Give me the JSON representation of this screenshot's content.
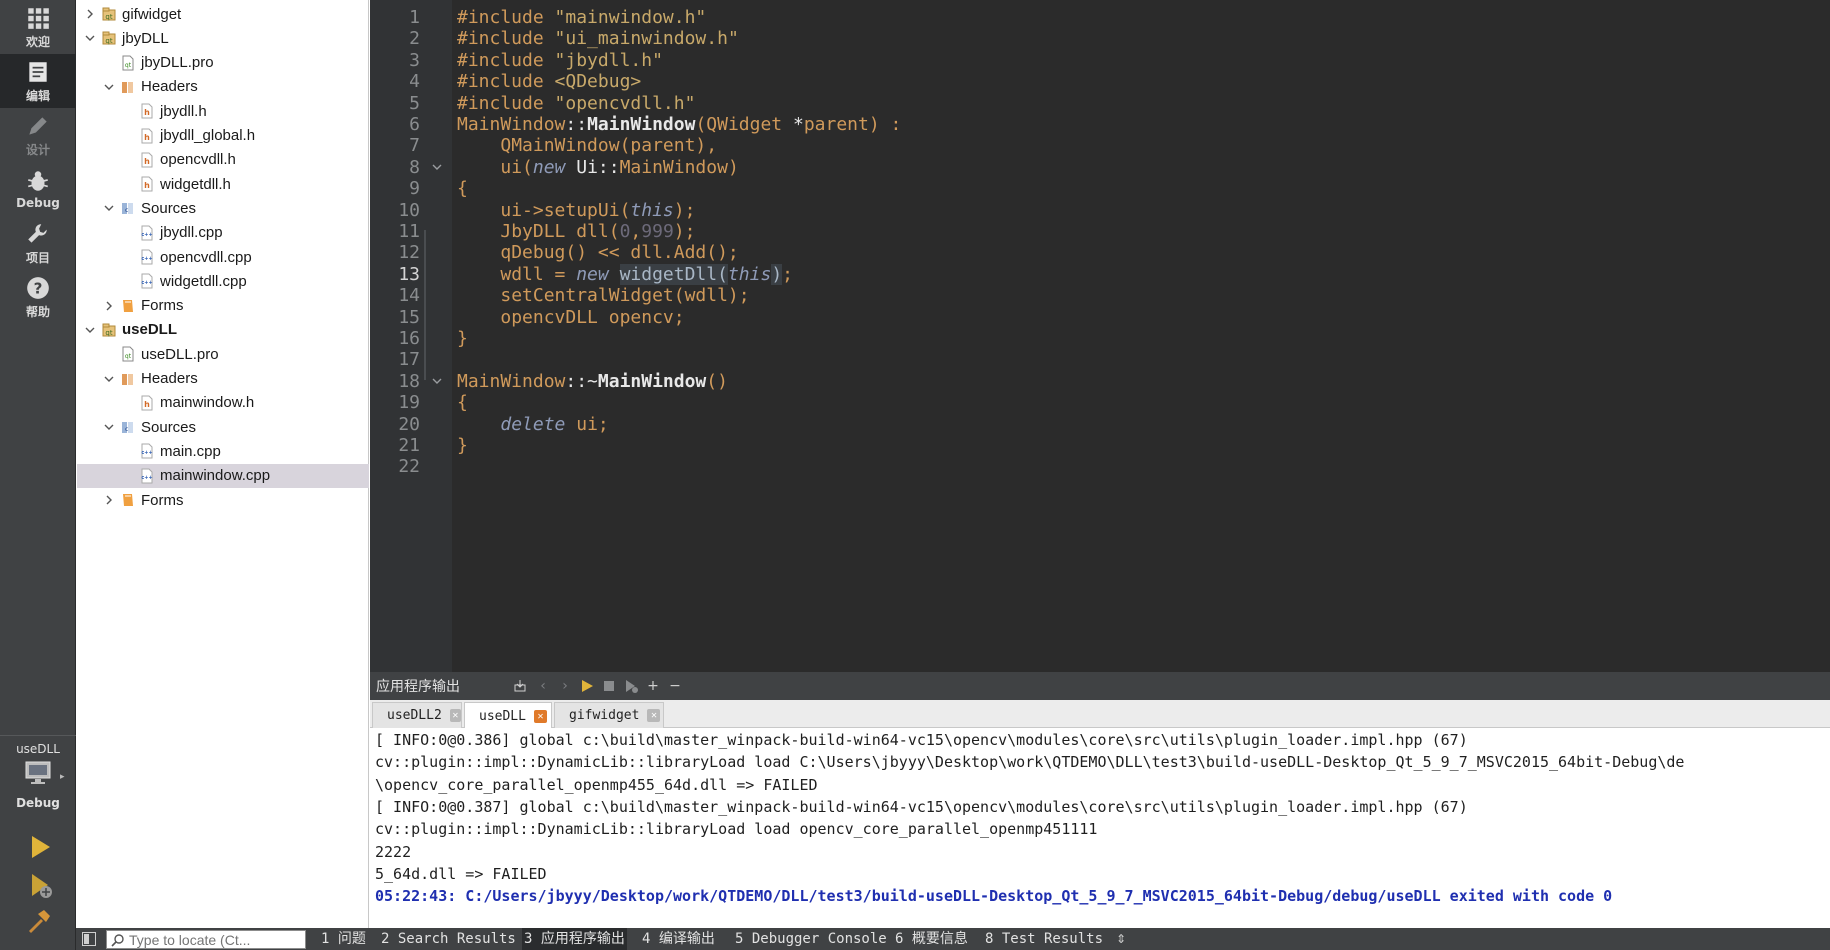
{
  "modes": [
    {
      "label": "欢迎",
      "icon": "grid-icon"
    },
    {
      "label": "编辑",
      "icon": "edit-document-icon"
    },
    {
      "label": "设计",
      "icon": "pencil-icon"
    },
    {
      "label": "Debug",
      "icon": "bug-icon"
    },
    {
      "label": "项目",
      "icon": "wrench-icon"
    },
    {
      "label": "帮助",
      "icon": "help-icon"
    }
  ],
  "kit": {
    "project": "useDLL",
    "config": "Debug"
  },
  "tree": [
    {
      "label": "gifwidget",
      "type": "project",
      "arrow": "right",
      "depth": 0,
      "bold": false
    },
    {
      "label": "jbyDLL",
      "type": "project",
      "arrow": "down",
      "depth": 0,
      "bold": false
    },
    {
      "label": "jbyDLL.pro",
      "type": "pro",
      "arrow": "",
      "depth": 1,
      "bold": false
    },
    {
      "label": "Headers",
      "type": "folder-h",
      "arrow": "down",
      "depth": 1,
      "bold": false
    },
    {
      "label": "jbydll.h",
      "type": "h",
      "arrow": "",
      "depth": 2,
      "bold": false
    },
    {
      "label": "jbydll_global.h",
      "type": "h",
      "arrow": "",
      "depth": 2,
      "bold": false
    },
    {
      "label": "opencvdll.h",
      "type": "h",
      "arrow": "",
      "depth": 2,
      "bold": false
    },
    {
      "label": "widgetdll.h",
      "type": "h",
      "arrow": "",
      "depth": 2,
      "bold": false
    },
    {
      "label": "Sources",
      "type": "folder-c",
      "arrow": "down",
      "depth": 1,
      "bold": false
    },
    {
      "label": "jbydll.cpp",
      "type": "cpp",
      "arrow": "",
      "depth": 2,
      "bold": false
    },
    {
      "label": "opencvdll.cpp",
      "type": "cpp",
      "arrow": "",
      "depth": 2,
      "bold": false
    },
    {
      "label": "widgetdll.cpp",
      "type": "cpp",
      "arrow": "",
      "depth": 2,
      "bold": false
    },
    {
      "label": "Forms",
      "type": "folder-f",
      "arrow": "right",
      "depth": 1,
      "bold": false
    },
    {
      "label": "useDLL",
      "type": "project",
      "arrow": "down",
      "depth": 0,
      "bold": true
    },
    {
      "label": "useDLL.pro",
      "type": "pro",
      "arrow": "",
      "depth": 1,
      "bold": false
    },
    {
      "label": "Headers",
      "type": "folder-h",
      "arrow": "down",
      "depth": 1,
      "bold": false
    },
    {
      "label": "mainwindow.h",
      "type": "h",
      "arrow": "",
      "depth": 2,
      "bold": false
    },
    {
      "label": "Sources",
      "type": "folder-c",
      "arrow": "down",
      "depth": 1,
      "bold": false
    },
    {
      "label": "main.cpp",
      "type": "cpp",
      "arrow": "",
      "depth": 2,
      "bold": false
    },
    {
      "label": "mainwindow.cpp",
      "type": "cpp",
      "arrow": "",
      "depth": 2,
      "bold": false,
      "selected": true
    },
    {
      "label": "Forms",
      "type": "folder-f",
      "arrow": "right",
      "depth": 1,
      "bold": false
    }
  ],
  "editor": {
    "current_line": "13",
    "lines": [
      {
        "n": "1",
        "fold": "",
        "tokens": [
          [
            "kw",
            "#include "
          ],
          [
            "str",
            "\"mainwindow.h\""
          ]
        ]
      },
      {
        "n": "2",
        "fold": "",
        "tokens": [
          [
            "kw",
            "#include "
          ],
          [
            "str",
            "\"ui_mainwindow.h\""
          ]
        ]
      },
      {
        "n": "3",
        "fold": "",
        "tokens": [
          [
            "kw",
            "#include "
          ],
          [
            "str",
            "\"jbydll.h\""
          ]
        ]
      },
      {
        "n": "4",
        "fold": "",
        "tokens": [
          [
            "kw",
            "#include "
          ],
          [
            "str",
            "<QDebug>"
          ]
        ]
      },
      {
        "n": "5",
        "fold": "",
        "tokens": [
          [
            "kw",
            "#include "
          ],
          [
            "str",
            "\"opencvdll.h\""
          ]
        ]
      },
      {
        "n": "6",
        "fold": "",
        "tokens": [
          [
            "cls",
            "MainWindow"
          ],
          [
            "std",
            "::"
          ],
          [
            "fn",
            "MainWindow"
          ],
          [
            "cls",
            "(QWidget "
          ],
          [
            "std",
            "*"
          ],
          [
            "cls",
            "parent) :"
          ]
        ]
      },
      {
        "n": "7",
        "fold": "",
        "tokens": [
          [
            "std",
            "    "
          ],
          [
            "cls",
            "QMainWindow(parent),"
          ]
        ]
      },
      {
        "n": "8",
        "fold": "down",
        "tokens": [
          [
            "std",
            "    "
          ],
          [
            "cls",
            "ui("
          ],
          [
            "ital",
            "new"
          ],
          [
            "std",
            " Ui::"
          ],
          [
            "cls",
            "MainWindow)"
          ]
        ]
      },
      {
        "n": "9",
        "fold": "",
        "tokens": [
          [
            "cls",
            "{"
          ]
        ]
      },
      {
        "n": "10",
        "fold": "",
        "tokens": [
          [
            "std",
            "    "
          ],
          [
            "cls",
            "ui->setupUi("
          ],
          [
            "ital",
            "this"
          ],
          [
            "cls",
            ");"
          ]
        ]
      },
      {
        "n": "11",
        "fold": "",
        "tokens": [
          [
            "std",
            "    "
          ],
          [
            "cls",
            "JbyDLL dll("
          ],
          [
            "num",
            "0"
          ],
          [
            "cls",
            ","
          ],
          [
            "num",
            "999"
          ],
          [
            "cls",
            ");"
          ]
        ]
      },
      {
        "n": "12",
        "fold": "",
        "tokens": [
          [
            "std",
            "    "
          ],
          [
            "cls",
            "qDebug() << dll.Add();"
          ]
        ]
      },
      {
        "n": "13",
        "fold": "",
        "tokens": [
          [
            "std",
            "    "
          ],
          [
            "cls",
            "wdll = "
          ],
          [
            "ital",
            "new"
          ],
          [
            "std",
            " "
          ],
          [
            "hl",
            "widgetDll("
          ],
          [
            "ital",
            "this"
          ],
          [
            "hl",
            ")"
          ],
          [
            "cls",
            ";"
          ]
        ]
      },
      {
        "n": "14",
        "fold": "",
        "tokens": [
          [
            "std",
            "    "
          ],
          [
            "cls",
            "setCentralWidget(wdll);"
          ]
        ]
      },
      {
        "n": "15",
        "fold": "",
        "tokens": [
          [
            "std",
            "    "
          ],
          [
            "cls",
            "opencvDLL opencv;"
          ]
        ]
      },
      {
        "n": "16",
        "fold": "",
        "tokens": [
          [
            "cls",
            "}"
          ]
        ]
      },
      {
        "n": "17",
        "fold": "",
        "tokens": []
      },
      {
        "n": "18",
        "fold": "down",
        "tokens": [
          [
            "cls",
            "MainWindow"
          ],
          [
            "std",
            "::~"
          ],
          [
            "fn",
            "MainWindow"
          ],
          [
            "cls",
            "()"
          ]
        ]
      },
      {
        "n": "19",
        "fold": "",
        "tokens": [
          [
            "cls",
            "{"
          ]
        ]
      },
      {
        "n": "20",
        "fold": "",
        "tokens": [
          [
            "std",
            "    "
          ],
          [
            "ital",
            "delete"
          ],
          [
            "cls",
            " ui;"
          ]
        ]
      },
      {
        "n": "21",
        "fold": "",
        "tokens": [
          [
            "cls",
            "}"
          ]
        ]
      },
      {
        "n": "22",
        "fold": "",
        "tokens": []
      }
    ]
  },
  "output": {
    "title": "应用程序输出",
    "tabs": [
      {
        "label": "useDLL2",
        "close": "gray",
        "active": false
      },
      {
        "label": "useDLL",
        "close": "orange",
        "active": true
      },
      {
        "label": "gifwidget",
        "close": "gray",
        "active": false
      }
    ],
    "lines": [
      {
        "text": "[ INFO:0@0.386] global c:\\build\\master_winpack-build-win64-vc15\\opencv\\modules\\core\\src\\utils\\plugin_loader.impl.hpp (67)",
        "exit": false
      },
      {
        "text": "cv::plugin::impl::DynamicLib::libraryLoad load C:\\Users\\jbyyy\\Desktop\\work\\QTDEMO\\DLL\\test3\\build-useDLL-Desktop_Qt_5_9_7_MSVC2015_64bit-Debug\\de",
        "exit": false
      },
      {
        "text": "\\opencv_core_parallel_openmp455_64d.dll => FAILED",
        "exit": false
      },
      {
        "text": "[ INFO:0@0.387] global c:\\build\\master_winpack-build-win64-vc15\\opencv\\modules\\core\\src\\utils\\plugin_loader.impl.hpp (67)",
        "exit": false
      },
      {
        "text": "cv::plugin::impl::DynamicLib::libraryLoad load opencv_core_parallel_openmp451111",
        "exit": false
      },
      {
        "text": "2222",
        "exit": false
      },
      {
        "text": "5_64d.dll => FAILED",
        "exit": false
      },
      {
        "text": "05:22:43: C:/Users/jbyyy/Desktop/work/QTDEMO/DLL/test3/build-useDLL-Desktop_Qt_5_9_7_MSVC2015_64bit-Debug/debug/useDLL exited with code 0",
        "exit": true
      }
    ]
  },
  "statusbar": {
    "locator_placeholder": "Type to locate (Ct...",
    "tabs": [
      {
        "label": "1 问题",
        "active": false
      },
      {
        "label": "2 Search Results",
        "active": false
      },
      {
        "label": "3 应用程序输出",
        "active": true
      },
      {
        "label": "4 编译输出",
        "active": false
      },
      {
        "label": "5 Debugger Console",
        "active": false
      },
      {
        "label": "6 概要信息",
        "active": false
      },
      {
        "label": "8 Test Results",
        "active": false
      }
    ]
  }
}
